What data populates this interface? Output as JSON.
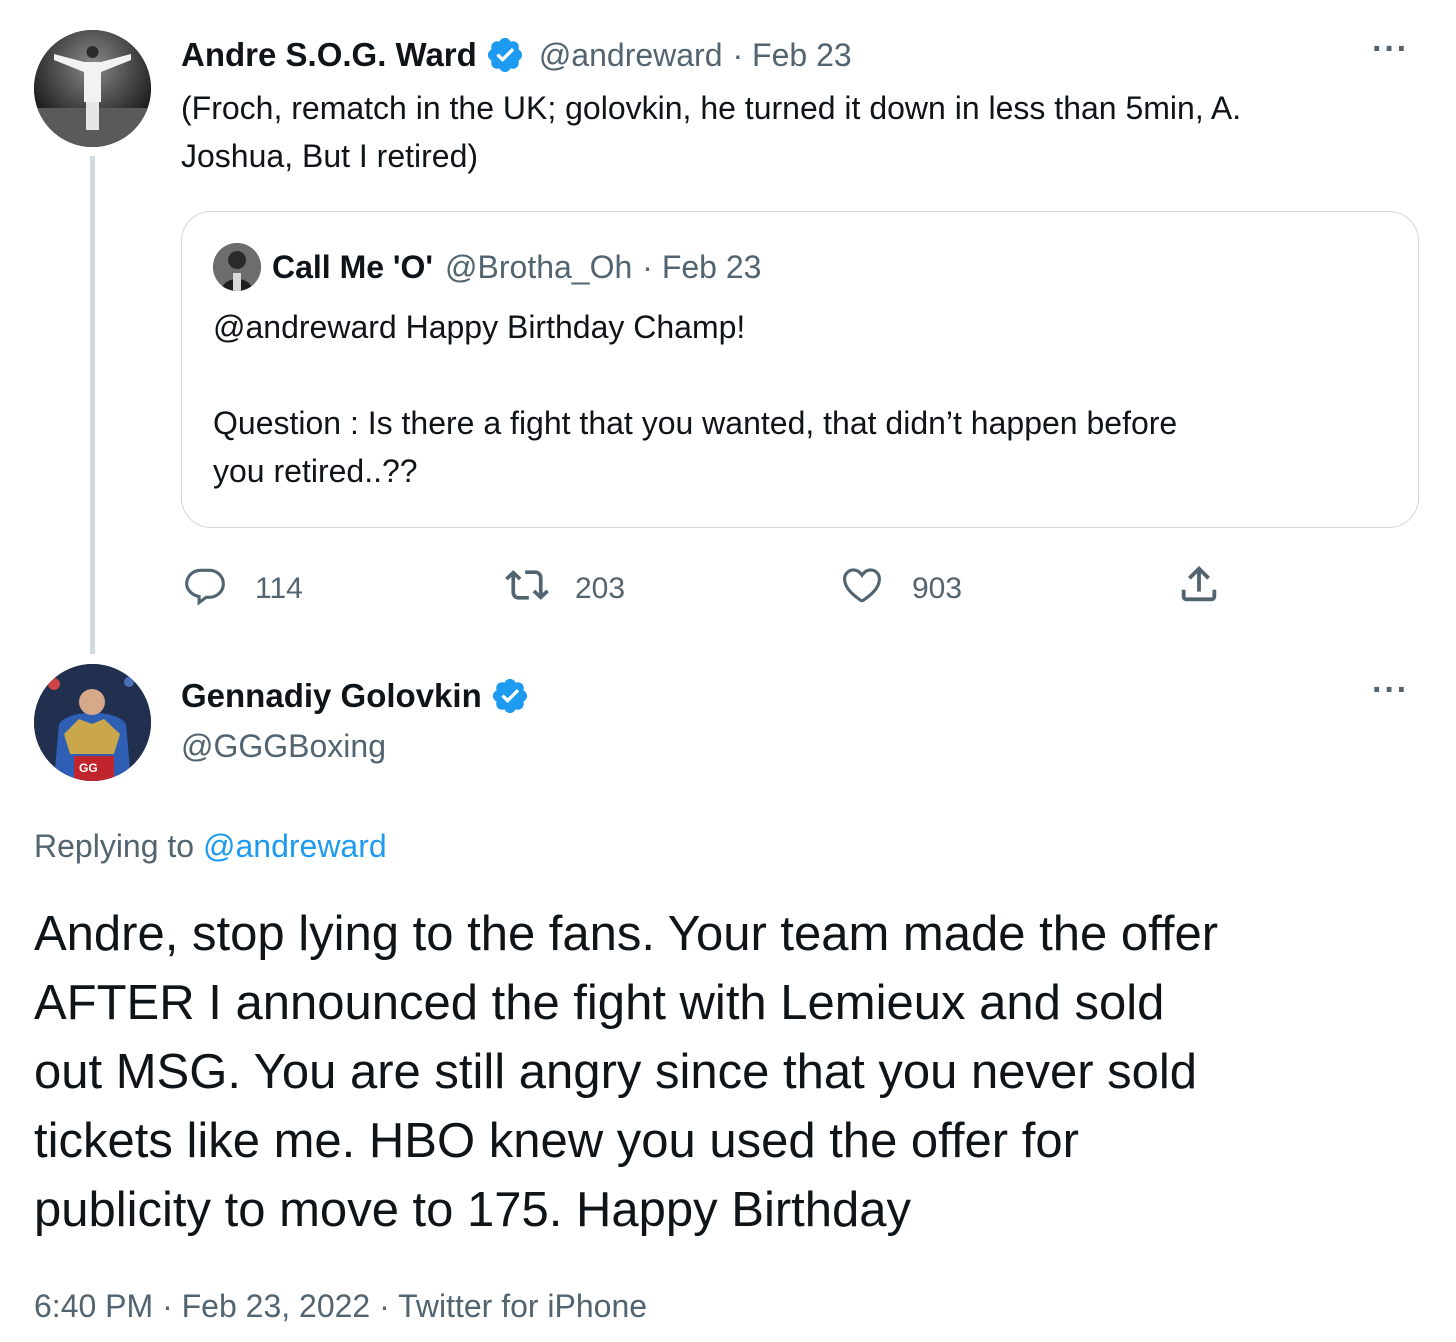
{
  "tweet1": {
    "author_name": "Andre S.O.G. Ward",
    "author_handle": "@andreward",
    "date": "· Feb 23",
    "text_line1": "(Froch, rematch in the UK; golovkin, he turned it down in less than 5min, A.",
    "text_line2": "Joshua, But I retired)",
    "more": "···",
    "quote": {
      "author_name": "Call Me 'O'",
      "author_handle": "@Brotha_Oh",
      "date": "· Feb 23",
      "line1": "@andreward Happy Birthday Champ!",
      "line2": "Question : Is there a fight that you wanted, that didn’t happen before",
      "line3": "you retired..??"
    },
    "actions": {
      "replies": "114",
      "retweets": "203",
      "likes": "903"
    }
  },
  "tweet2": {
    "author_name": "Gennadiy Golovkin",
    "author_handle": "@GGGBoxing",
    "more": "···",
    "replying_prefix": "Replying to",
    "replying_handle": "@andreward",
    "lines": [
      "Andre, stop lying to the fans. Your team made the offer",
      "AFTER I announced the fight with Lemieux and sold",
      "out MSG. You are still angry since that you never sold",
      "tickets like me. HBO knew you used the offer for",
      "publicity to move to 175. Happy Birthday"
    ],
    "timestamp": "6:40 PM · Feb 23, 2022 · Twitter for iPhone"
  },
  "colors": {
    "accent": "#1d9bf0",
    "secondary_text": "#536471",
    "thread_line": "#cfd9de"
  }
}
